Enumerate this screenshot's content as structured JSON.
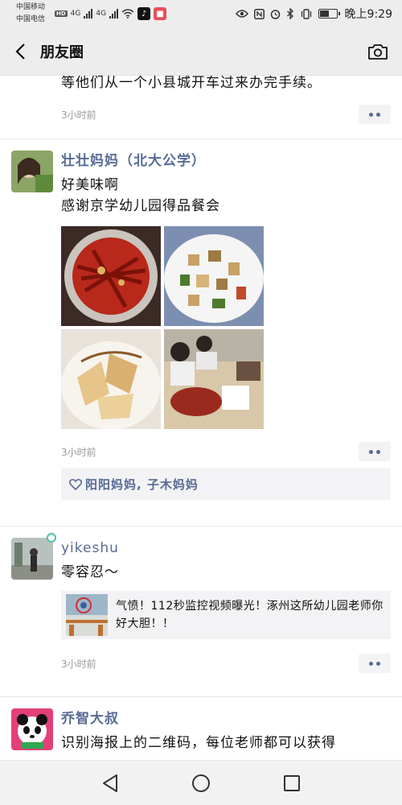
{
  "status_bar": {
    "carrier1": "中国移动",
    "carrier2": "中国电信",
    "hd": "HD",
    "net1": "4G",
    "net2": "4G",
    "time": "晚上9:29",
    "battery_level": 0.5
  },
  "nav": {
    "title": "朋友圈"
  },
  "posts": [
    {
      "text": "等他们从一个小县城开车过来办完手续。",
      "time": "3小时前"
    },
    {
      "author": "壮壮妈妈（北大公学）",
      "text1": "好美味啊",
      "text2": "感谢京学幼儿园得品餐会",
      "time": "3小时前",
      "likes": "阳阳妈妈, 子木妈妈"
    },
    {
      "author": "yikeshu",
      "text": "零容忍～",
      "link_title": "气愤！112秒监控视频曝光！涿州这所幼儿园老师你好大胆！！",
      "time": "3小时前"
    },
    {
      "author": "乔智大叔",
      "text": "识别海报上的二维码，每位老师都可以获得"
    }
  ],
  "colors": {
    "author_blue": "#576b95",
    "bar_bg": "#ededed"
  }
}
